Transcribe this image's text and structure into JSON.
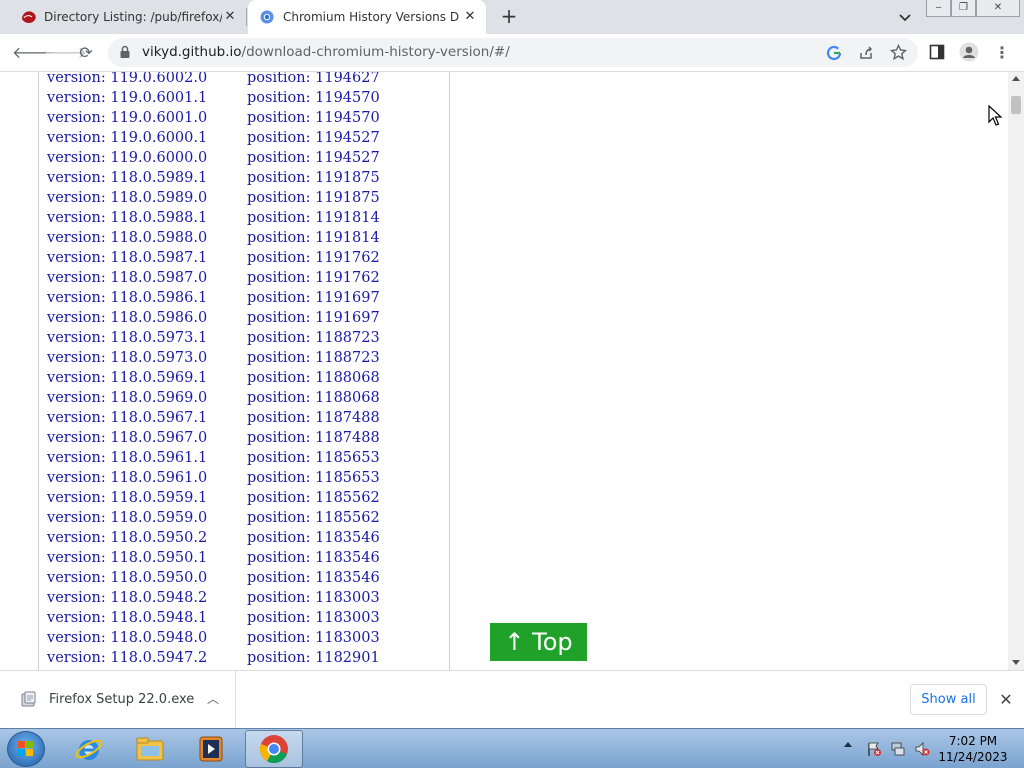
{
  "tabs": [
    {
      "title": "Directory Listing: /pub/firefox/rel",
      "icon": "firefox-ftp-icon",
      "active": false
    },
    {
      "title": "Chromium History Versions Dow",
      "icon": "chromium-icon",
      "active": true
    }
  ],
  "toolbar": {
    "url_host": "vikyd.github.io",
    "url_path": "/download-chromium-history-version/#/"
  },
  "versions": [
    {
      "version": "version: 119.0.6002.0",
      "position": "position: 1194627"
    },
    {
      "version": "version: 119.0.6001.1",
      "position": "position: 1194570"
    },
    {
      "version": "version: 119.0.6001.0",
      "position": "position: 1194570"
    },
    {
      "version": "version: 119.0.6000.1",
      "position": "position: 1194527"
    },
    {
      "version": "version: 119.0.6000.0",
      "position": "position: 1194527"
    },
    {
      "version": "version: 118.0.5989.1",
      "position": "position: 1191875"
    },
    {
      "version": "version: 118.0.5989.0",
      "position": "position: 1191875"
    },
    {
      "version": "version: 118.0.5988.1",
      "position": "position: 1191814"
    },
    {
      "version": "version: 118.0.5988.0",
      "position": "position: 1191814"
    },
    {
      "version": "version: 118.0.5987.1",
      "position": "position: 1191762"
    },
    {
      "version": "version: 118.0.5987.0",
      "position": "position: 1191762"
    },
    {
      "version": "version: 118.0.5986.1",
      "position": "position: 1191697"
    },
    {
      "version": "version: 118.0.5986.0",
      "position": "position: 1191697"
    },
    {
      "version": "version: 118.0.5973.1",
      "position": "position: 1188723"
    },
    {
      "version": "version: 118.0.5973.0",
      "position": "position: 1188723"
    },
    {
      "version": "version: 118.0.5969.1",
      "position": "position: 1188068"
    },
    {
      "version": "version: 118.0.5969.0",
      "position": "position: 1188068"
    },
    {
      "version": "version: 118.0.5967.1",
      "position": "position: 1187488"
    },
    {
      "version": "version: 118.0.5967.0",
      "position": "position: 1187488"
    },
    {
      "version": "version: 118.0.5961.1",
      "position": "position: 1185653"
    },
    {
      "version": "version: 118.0.5961.0",
      "position": "position: 1185653"
    },
    {
      "version": "version: 118.0.5959.1",
      "position": "position: 1185562"
    },
    {
      "version": "version: 118.0.5959.0",
      "position": "position: 1185562"
    },
    {
      "version": "version: 118.0.5950.2",
      "position": "position: 1183546"
    },
    {
      "version": "version: 118.0.5950.1",
      "position": "position: 1183546"
    },
    {
      "version": "version: 118.0.5950.0",
      "position": "position: 1183546"
    },
    {
      "version": "version: 118.0.5948.2",
      "position": "position: 1183003"
    },
    {
      "version": "version: 118.0.5948.1",
      "position": "position: 1183003"
    },
    {
      "version": "version: 118.0.5948.0",
      "position": "position: 1183003"
    },
    {
      "version": "version: 118.0.5947.2",
      "position": "position: 1182901"
    }
  ],
  "top_button": {
    "label": "↑ Top",
    "color": "#1fa12a"
  },
  "download_bar": {
    "filename": "Firefox Setup 22.0.exe",
    "show_all_label": "Show all"
  },
  "taskbar": {
    "apps": [
      "internet-explorer-icon",
      "windows-explorer-icon",
      "media-player-icon",
      "chrome-icon"
    ],
    "clock_time": "7:02 PM",
    "clock_date": "11/24/2023"
  }
}
